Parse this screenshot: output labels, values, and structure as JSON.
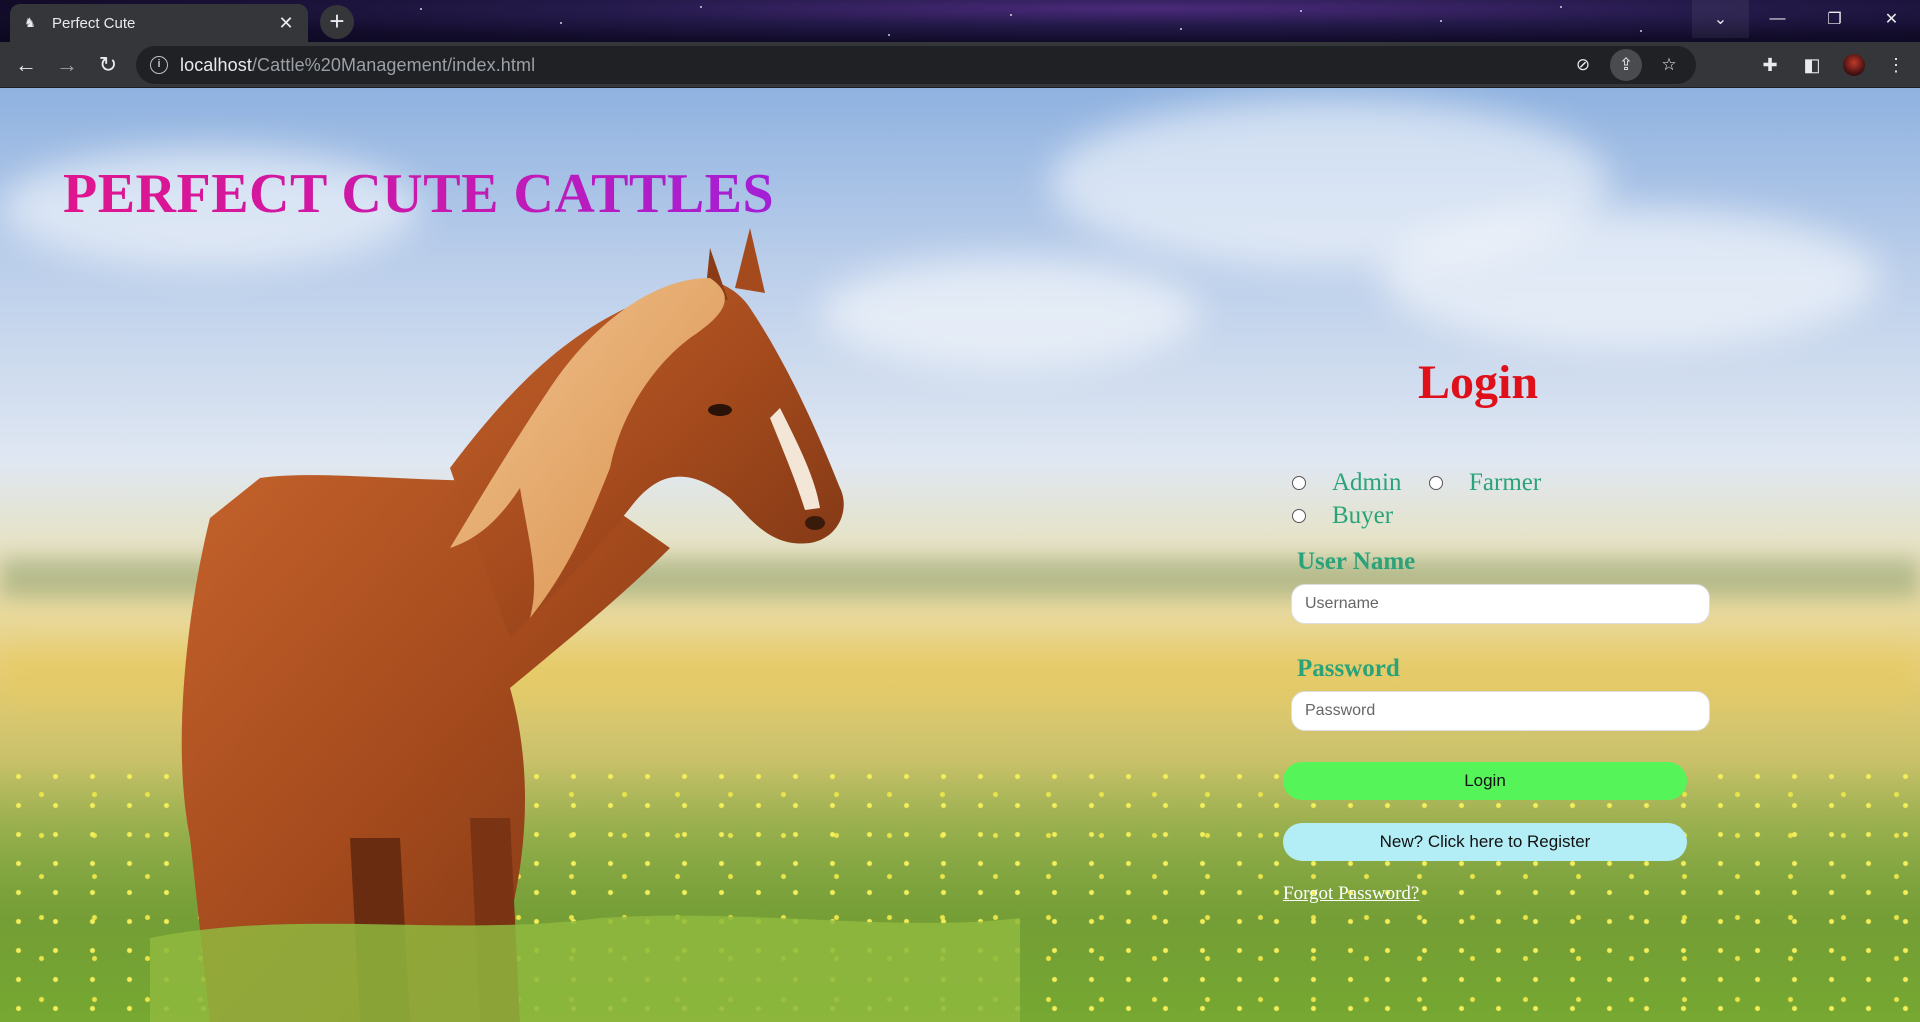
{
  "browser": {
    "tab_title": "Perfect Cute",
    "tab_close_icon": "close-icon",
    "new_tab_icon": "plus-icon",
    "url_host": "localhost",
    "url_path": "/Cattle%20Management/index.html",
    "window_controls": [
      "chevron-down-icon",
      "minimize-icon",
      "restore-icon",
      "close-icon"
    ]
  },
  "page": {
    "site_title": "PERFECT CUTE CATTLES",
    "login": {
      "heading": "Login",
      "roles": [
        "Admin",
        "Farmer",
        "Buyer"
      ],
      "username_label": "User Name",
      "username_placeholder": "Username",
      "password_label": "Password",
      "password_placeholder": "Password",
      "login_button": "Login",
      "register_button": "New? Click here to Register",
      "forgot_link": "Forgot Password?"
    },
    "colors": {
      "title_gradient_start": "#e0158d",
      "title_gradient_end": "#a31fd6",
      "login_heading": "#e0101b",
      "label_green": "#2aa37a",
      "login_button_bg": "#55f55a",
      "register_button_bg": "#b3eef7"
    }
  }
}
